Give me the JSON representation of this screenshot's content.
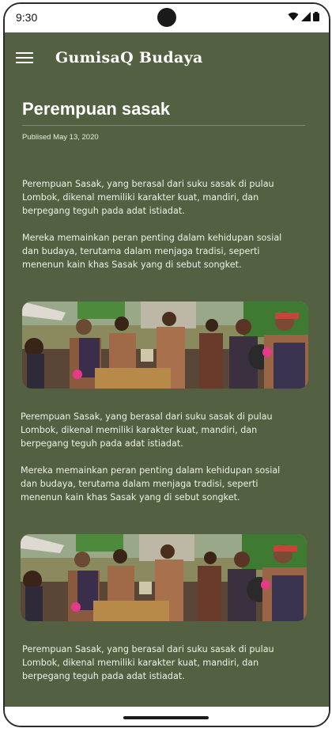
{
  "status_bar": {
    "time": "9:30",
    "icons": [
      "wifi-icon",
      "cellular-icon",
      "battery-icon"
    ]
  },
  "app_bar": {
    "title": "GumisaQ Budaya",
    "menu_icon": "hamburger-menu-icon"
  },
  "article": {
    "title": "Perempuan sasak",
    "published": "Publised May 13, 2020",
    "blocks": [
      {
        "type": "text",
        "lines": [
          "Perempuan Sasak, yang berasal dari suku sasak di pulau",
          "Lombok, dikenal memiliki karakter kuat, mandiri, dan",
          "berpegang teguh pada adat istiadat."
        ]
      },
      {
        "type": "text",
        "lines": [
          "Mereka memainkan peran penting dalam kehidupan sosial",
          "dan budaya, terutama dalam menjaga tradisi, seperti",
          "menenun kain khas Sasak yang di sebut songket."
        ]
      },
      {
        "type": "image",
        "subject": "sasak-ceremony-drummers"
      },
      {
        "type": "text",
        "lines": [
          "Perempuan Sasak, yang berasal dari suku sasak di pulau",
          "Lombok, dikenal memiliki karakter kuat, mandiri, dan",
          "berpegang teguh pada adat istiadat."
        ]
      },
      {
        "type": "text",
        "lines": [
          "Mereka memainkan peran penting dalam kehidupan sosial",
          "dan budaya, terutama dalam menjaga tradisi, seperti",
          "menenun kain khas Sasak yang di sebut songket."
        ]
      },
      {
        "type": "image",
        "subject": "sasak-ceremony-drummers"
      },
      {
        "type": "text",
        "lines": [
          "Perempuan Sasak, yang berasal dari suku sasak di pulau",
          "Lombok, dikenal memiliki karakter kuat, mandiri, dan",
          "berpegang teguh pada adat istiadat."
        ]
      }
    ]
  },
  "colors": {
    "background": "#536142",
    "text": "#eef1e8",
    "title": "#ffffff"
  }
}
